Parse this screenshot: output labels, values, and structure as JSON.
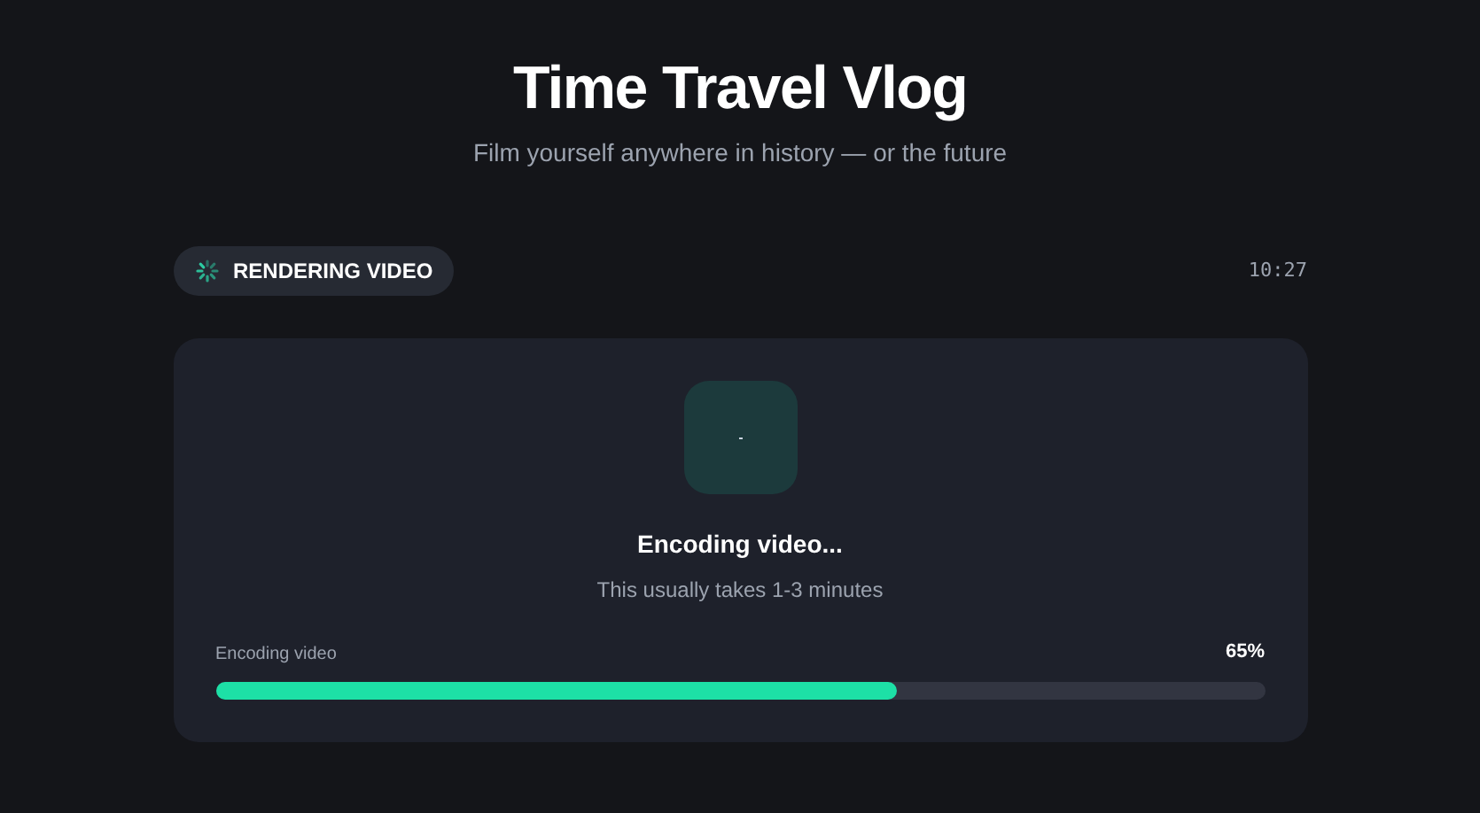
{
  "header": {
    "title": "Time Travel Vlog",
    "subtitle": "Film yourself anywhere in history — or the future"
  },
  "status": {
    "label": "RENDERING VIDEO",
    "busy": true,
    "time": "10:27"
  },
  "card": {
    "heading": "Encoding video...",
    "note": "This usually takes 1-3 minutes",
    "progress_label": "Encoding video",
    "reading": "65%",
    "level": 0.65
  }
}
